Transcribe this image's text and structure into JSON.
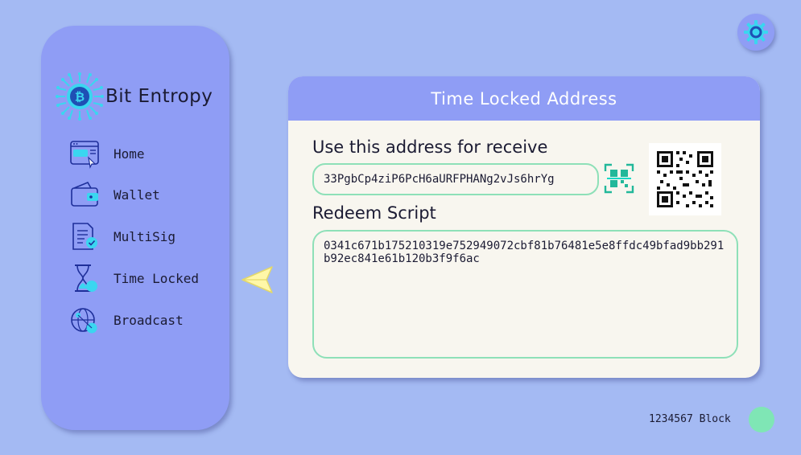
{
  "app": {
    "brand_name": "Bit Entropy",
    "brand_icon": "bitcoin-chip-icon"
  },
  "sidebar": {
    "items": [
      {
        "label": "Home",
        "icon": "home-browser-icon"
      },
      {
        "label": "Wallet",
        "icon": "wallet-icon"
      },
      {
        "label": "MultiSig",
        "icon": "multisig-document-icon"
      },
      {
        "label": "Time Locked",
        "icon": "hourglass-icon"
      },
      {
        "label": "Broadcast",
        "icon": "globe-broadcast-icon"
      }
    ]
  },
  "card": {
    "title": "Time Locked Address",
    "address_label": "Use this address for receive",
    "address_value": "33PgbCp4ziP6PcH6aURFPHANg2vJs6hrYg",
    "script_label": "Redeem Script",
    "script_value": "0341c671b175210319e752949072cbf81b76481e5e8ffdc49bfad9bb291b92ec841e61b120b3f9f6ac"
  },
  "footer": {
    "block_text": "1234567 Block"
  },
  "colors": {
    "background": "#a4baf3",
    "panel": "#8f9df5",
    "card": "#f8f6ef",
    "accent_green": "#8ee0b8",
    "status_green": "#7fe6b5",
    "icon_cyan": "#3ad6f0"
  }
}
